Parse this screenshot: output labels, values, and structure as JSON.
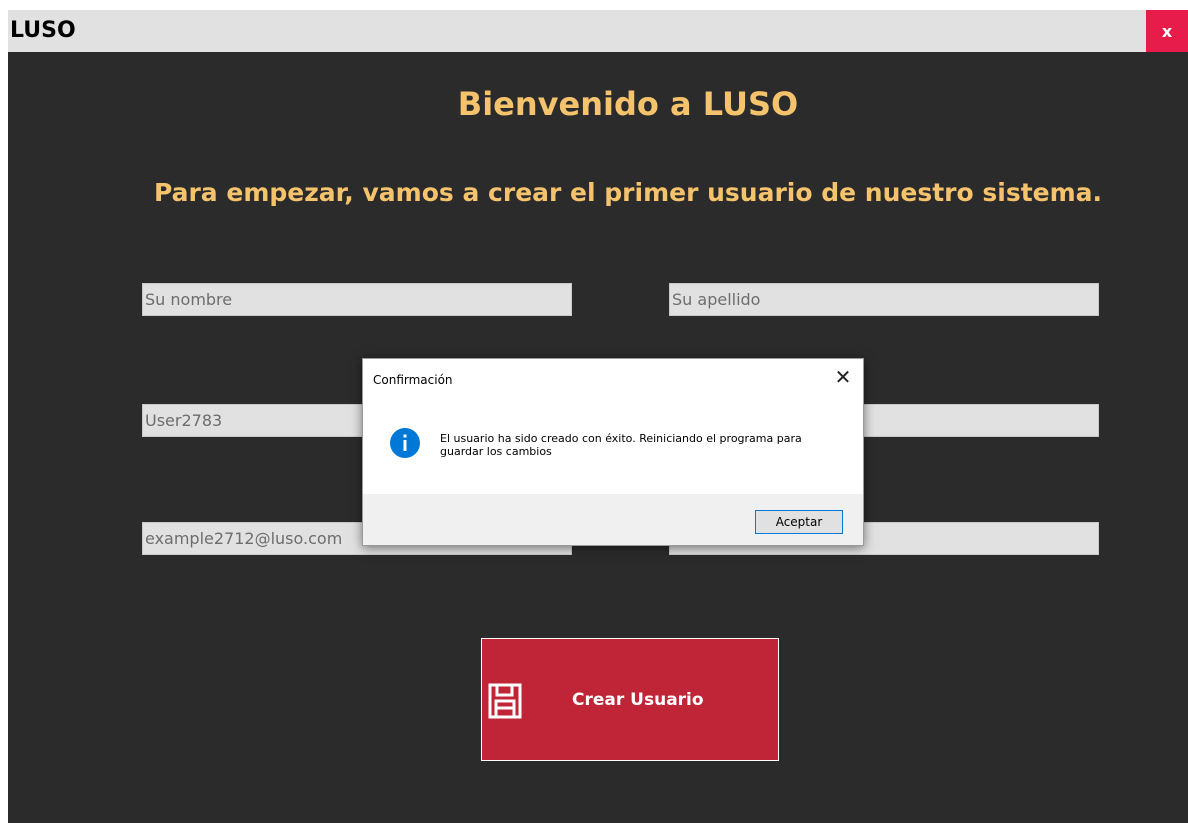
{
  "window": {
    "title": "LUSO",
    "close_label": "x"
  },
  "main": {
    "heading": "Bienvenido a LUSO",
    "subheading": "Para empezar, vamos a crear el primer usuario de nuestro sistema.",
    "fields": {
      "first_name": "Su nombre",
      "last_name": "Su apellido",
      "username": "User2783",
      "password": "",
      "email": "example2712@luso.com",
      "extra": ""
    },
    "create_button_label": "Crear Usuario"
  },
  "dialog": {
    "title": "Confirmación",
    "close_label": "✕",
    "message": "El usuario ha sido creado con éxito. Reiniciando el programa para guardar los cambios",
    "ok_label": "Aceptar"
  },
  "colors": {
    "background": "#2b2b2b",
    "heading": "#f6c36d",
    "button": "#c02537",
    "close": "#e81c4a",
    "info_icon": "#0078d7"
  },
  "icons": {
    "save": "floppy-disk-icon",
    "info": "info-icon"
  }
}
